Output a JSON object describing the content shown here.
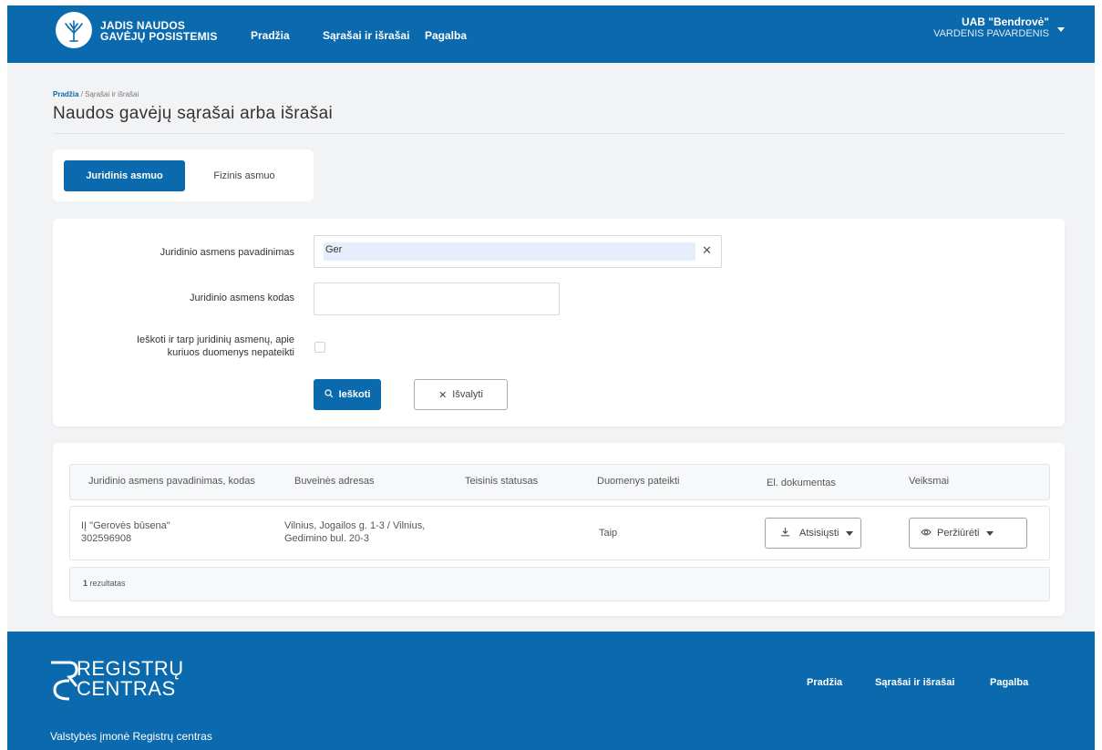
{
  "header": {
    "brand_line1": "JADIS NAUDOS",
    "brand_line2": "GAVĖJŲ POSISTEMIS",
    "nav": [
      "Pradžia",
      "Sąrašai ir išrašai",
      "Pagalba"
    ],
    "user_org": "UAB \"Bendrovė\"",
    "user_name": "VARDENIS PAVARDENIS"
  },
  "breadcrumb": {
    "home": "Pradžia",
    "current": "Sąrašai ir išrašai",
    "separator": " / "
  },
  "page_title": "Naudos gavėjų sąrašai arba išrašai",
  "tabs": [
    {
      "label": "Juridinis asmuo",
      "active": true
    },
    {
      "label": "Fizinis asmuo",
      "active": false
    }
  ],
  "form": {
    "name_label": "Juridinio asmens pavadinimas",
    "name_value": "Ger",
    "code_label": "Juridinio asmens kodas",
    "code_value": "",
    "checkbox_label_line1": "Ieškoti ir tarp juridinių asmenų, apie",
    "checkbox_label_line2": "kuriuos duomenys nepateikti",
    "checkbox_checked": false,
    "search_button": "Ieškoti",
    "clear_button": "Išvalyti"
  },
  "table": {
    "columns": [
      "Juridinio asmens pavadinimas, kodas",
      "Buveinės adresas",
      "Teisinis statusas",
      "Duomenys pateikti",
      "El. dokumentas",
      "Veiksmai"
    ],
    "rows": [
      {
        "name": "IĮ \"Gerovės būsena\"",
        "code": "302596908",
        "address_line1": "Vilnius, Jogailos g. 1-3 / Vilnius,",
        "address_line2": "Gedimino bul. 20-3",
        "status": "",
        "submitted": "Taip",
        "download_label": "Atsisiųsti",
        "view_label": "Peržiūrėti"
      }
    ],
    "result_count": "1",
    "result_word": "rezultatas"
  },
  "footer": {
    "logo_line1": "REGISTRŲ",
    "logo_line2": "CENTRAS",
    "subtitle": "Valstybės įmonė Registrų centras",
    "nav": [
      "Pradžia",
      "Sąrašai ir išrašai",
      "Pagalba"
    ]
  },
  "colors": {
    "brand": "#0b6aad",
    "background": "#f2f3f5",
    "input_fill": "#e6eefb"
  },
  "icons": [
    "tree-logo-icon",
    "user-menu-caret-icon",
    "search-icon",
    "close-icon",
    "clear-x-icon",
    "download-icon",
    "eye-icon",
    "caret-down-icon",
    "registru-centras-logo-icon"
  ]
}
